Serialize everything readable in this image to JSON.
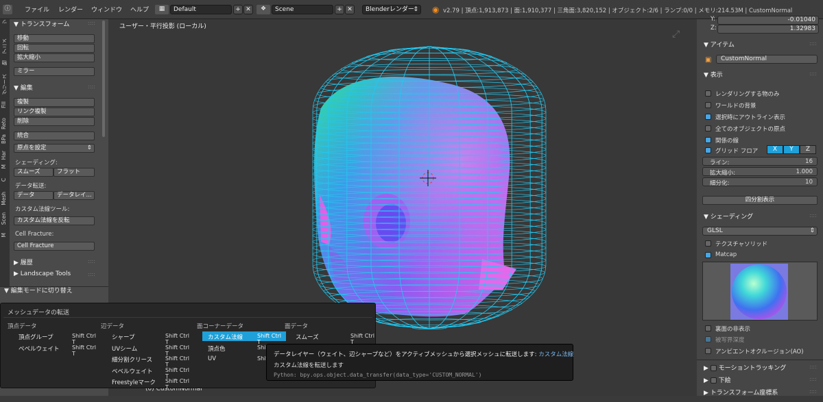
{
  "menu": [
    "ファイル",
    "レンダー",
    "ウィンドウ",
    "ヘルプ"
  ],
  "layout_field": "Default",
  "scene_field": "Scene",
  "renderer": "Blenderレンダー",
  "stats": "v2.79 | 頂点:1,913,873 | 面:1,910,377 | 三角面:3,820,152 | オブジェクト:2/6 | ランプ:0/0 | メモリ:214.53M | CustomNormal",
  "left_tabs": [
    "ツ",
    "アニメ",
    "物",
    "グリース",
    "Fill",
    "Reto",
    "BPa",
    "Har",
    "M",
    "C",
    "Mesh",
    "Scen",
    "M"
  ],
  "transform": {
    "title": "トランスフォーム",
    "buttons": [
      "移動",
      "回転",
      "拡大縮小",
      "ミラー"
    ]
  },
  "edit": {
    "title": "編集",
    "buttons": [
      "複製",
      "リンク複製",
      "削除",
      "統合"
    ],
    "origin": "原点を設定",
    "shading_label": "シェーディング:",
    "smooth": "スムーズ",
    "flat": "フラット",
    "data_transfer_label": "データ転送:",
    "data": "データ",
    "data_layer": "データレイ...",
    "custom_normal_label": "カスタム法線ツール:",
    "flip_normal": "カスタム法線を反転",
    "cell_fracture_label": "Cell Fracture:",
    "cell_fracture_btn": "Cell Fracture"
  },
  "history": "履歴",
  "landscape": "Landscape Tools",
  "mode_switch": "編集モードに切り替え",
  "viewport_label": "ユーザー・平行投影 (ローカル)",
  "object_name": "(0) CustomNormal",
  "props": {
    "y_label": "Y:",
    "y_value": "-0.01040",
    "z_label": "Z:",
    "z_value": "1.32983",
    "item_title": "アイテム",
    "item_name": "CustomNormal",
    "display_title": "表示",
    "checks": [
      {
        "label": "レンダリングする物のみ",
        "on": false
      },
      {
        "label": "ワールドの背景",
        "on": false
      },
      {
        "label": "選択時にアウトライン表示",
        "on": true
      },
      {
        "label": "全てのオブジェクトの原点",
        "on": false
      },
      {
        "label": "関係の線",
        "on": true
      }
    ],
    "grid_floor": "グリッド フロア",
    "axes": [
      "X",
      "Y",
      "Z"
    ],
    "lines_label": "ライン:",
    "lines_value": "16",
    "scale_label": "拡大縮小:",
    "scale_value": "1.000",
    "sub_label": "細分化:",
    "sub_value": "10",
    "quad_view": "四分割表示",
    "shading_title": "シェーディング",
    "glsl": "GLSL",
    "textured_solid": "テクスチャソリッド",
    "matcap": "Matcap",
    "backface": "裏面の非表示",
    "depth": "被写界深度",
    "ao": "アンビエントオクルージョン(AO)",
    "motion": "モーショントラッキング",
    "underlay": "下絵",
    "transform_orient": "トランスフォーム座標系"
  },
  "popup": {
    "title": "メッシュデータの転送",
    "cols": [
      {
        "header": "頂点データ",
        "items": [
          {
            "label": "頂点グループ",
            "key": "Shift Ctrl T"
          },
          {
            "label": "ベベルウェイト",
            "key": "Shift Ctrl T"
          }
        ]
      },
      {
        "header": "辺データ",
        "items": [
          {
            "label": "シャープ",
            "key": "Shift Ctrl T"
          },
          {
            "label": "UVシーム",
            "key": "Shift Ctrl T"
          },
          {
            "label": "細分割クリース",
            "key": "Shift Ctrl T"
          },
          {
            "label": "ベベルウェイト",
            "key": "Shift Ctrl T"
          },
          {
            "label": "Freestyleマーク",
            "key": "Shift Ctrl T"
          }
        ]
      },
      {
        "header": "面コーナーデータ",
        "items": [
          {
            "label": "カスタム法線",
            "key": "Shift Ctrl T"
          },
          {
            "label": "頂点色",
            "key": "Shift C"
          },
          {
            "label": "UV",
            "key": "Shift C"
          }
        ]
      },
      {
        "header": "面データ",
        "items": [
          {
            "label": "スムーズ",
            "key": "Shift Ctrl T"
          }
        ]
      }
    ]
  },
  "tooltip": {
    "line1": "データレイヤー（ウェイト、辺シャープなど）をアクティブメッシュから選択メッシュに転送します:",
    "line1_accent": "カスタム法線",
    "line2": "カスタム法線を転送します",
    "line3": "Python: bpy.ops.object.data_transfer(data_type='CUSTOM_NORMAL')"
  },
  "colors": {
    "accent": "#46a6e6",
    "selected": "#1fa0d8",
    "wire": "#23c8f0"
  }
}
